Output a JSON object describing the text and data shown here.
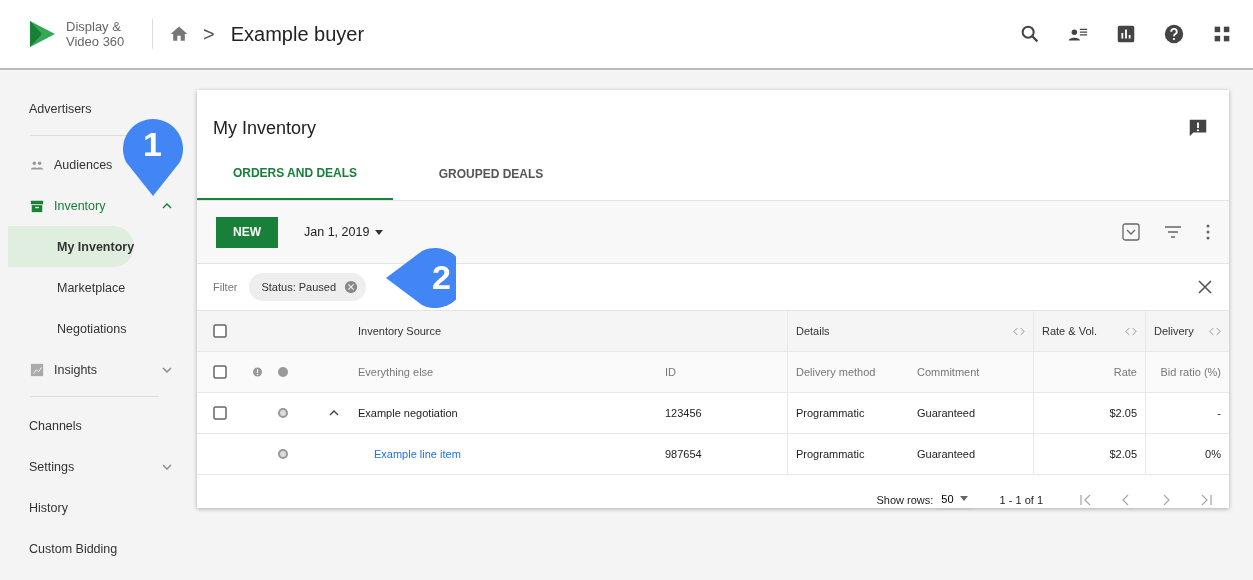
{
  "header": {
    "logo_line1": "Display &",
    "logo_line2": "Video 360",
    "breadcrumb_separator": ">",
    "title": "Example buyer"
  },
  "sidebar": {
    "items": [
      {
        "label": "Advertisers",
        "kind": "plain",
        "selected": false,
        "divider_after": true
      },
      {
        "label": "Audiences",
        "kind": "section",
        "selected": false,
        "divider_after": false
      },
      {
        "label": "Inventory",
        "kind": "section",
        "selected": false,
        "active": true,
        "expanded": true,
        "divider_after": false
      },
      {
        "label": "My Inventory",
        "kind": "sub",
        "selected": true,
        "divider_after": false
      },
      {
        "label": "Marketplace",
        "kind": "sub",
        "selected": false,
        "divider_after": false
      },
      {
        "label": "Negotiations",
        "kind": "sub",
        "selected": false,
        "divider_after": false
      },
      {
        "label": "Insights",
        "kind": "section",
        "selected": false,
        "expanded": false,
        "divider_after": true
      },
      {
        "label": "Channels",
        "kind": "plain",
        "selected": false,
        "divider_after": false
      },
      {
        "label": "Settings",
        "kind": "plain",
        "selected": false,
        "expanded": false,
        "divider_after": false
      },
      {
        "label": "History",
        "kind": "plain",
        "selected": false,
        "divider_after": false
      },
      {
        "label": "Custom Bidding",
        "kind": "plain",
        "selected": false,
        "divider_after": false
      }
    ]
  },
  "card": {
    "title": "My Inventory",
    "tabs": [
      {
        "label": "ORDERS AND DEALS",
        "selected": true
      },
      {
        "label": "GROUPED DEALS",
        "selected": false
      }
    ],
    "toolbar": {
      "new_button": "NEW",
      "date": "Jan 1, 2019"
    },
    "filter": {
      "label": "Filter",
      "chips": [
        "Status: Paused"
      ]
    },
    "table": {
      "header_checked": false,
      "subheader_checked": false,
      "groups": [
        {
          "label": "Inventory Source"
        },
        {
          "label": "Details"
        },
        {
          "label": "Rate & Vol."
        },
        {
          "label": "Delivery"
        }
      ],
      "columns": [
        "Everything else",
        "ID",
        "Delivery method",
        "Commitment",
        "Rate",
        "Bid ratio (%)"
      ],
      "rows": [
        {
          "kind": "negotiation",
          "expanded": true,
          "checked": false,
          "source": "Example negotiation",
          "id": "123456",
          "delivery_method": "Programmatic",
          "commitment": "Guaranteed",
          "rate": "$2.05",
          "bid_ratio": "-"
        },
        {
          "kind": "line_item",
          "source": "Example line item",
          "id": "987654",
          "delivery_method": "Programmatic",
          "commitment": "Guaranteed",
          "rate": "$2.05",
          "bid_ratio": "0%"
        }
      ]
    },
    "pagination": {
      "label": "Show rows:",
      "rows": "50",
      "range": "1 - 1 of 1"
    }
  },
  "callouts": [
    {
      "label": "1"
    },
    {
      "label": "2"
    }
  ]
}
